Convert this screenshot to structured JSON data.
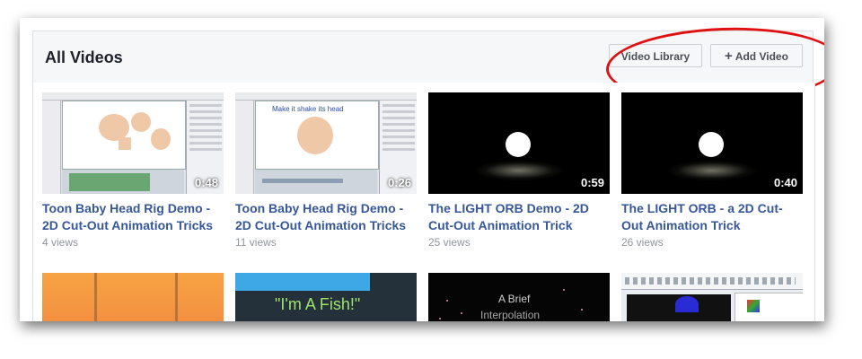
{
  "header": {
    "title": "All Videos",
    "video_library_label": "Video Library",
    "add_video_label": "Add Video",
    "add_video_icon": "plus-icon"
  },
  "annotation": {
    "color": "#e01010",
    "shape": "ellipse-highlight"
  },
  "videos": [
    {
      "title_line1": "Toon Baby Head Rig Demo -",
      "title_line2": "2D Cut-Out Animation Tricks",
      "views": "4 views",
      "duration": "0:48"
    },
    {
      "title_line1": "Toon Baby Head Rig Demo -",
      "title_line2": "2D Cut-Out Animation Tricks",
      "views": "11 views",
      "duration": "0:26",
      "thumb_caption": "Make it shake its head"
    },
    {
      "title_line1": "The LIGHT ORB Demo - 2D",
      "title_line2": "Cut-Out Animation Trick",
      "views": "25 views",
      "duration": "0:59"
    },
    {
      "title_line1": "The LIGHT ORB - a 2D Cut-",
      "title_line2": "Out Animation Trick",
      "views": "26 views",
      "duration": "0:40"
    },
    {},
    {
      "thumb_caption": "\"I'm A Fish!\""
    },
    {
      "thumb_caption": "A Brief",
      "thumb_caption2": "Interpolation"
    },
    {}
  ],
  "colors": {
    "link": "#365899",
    "muted": "#90949c",
    "header_bg": "#f6f7f9"
  }
}
